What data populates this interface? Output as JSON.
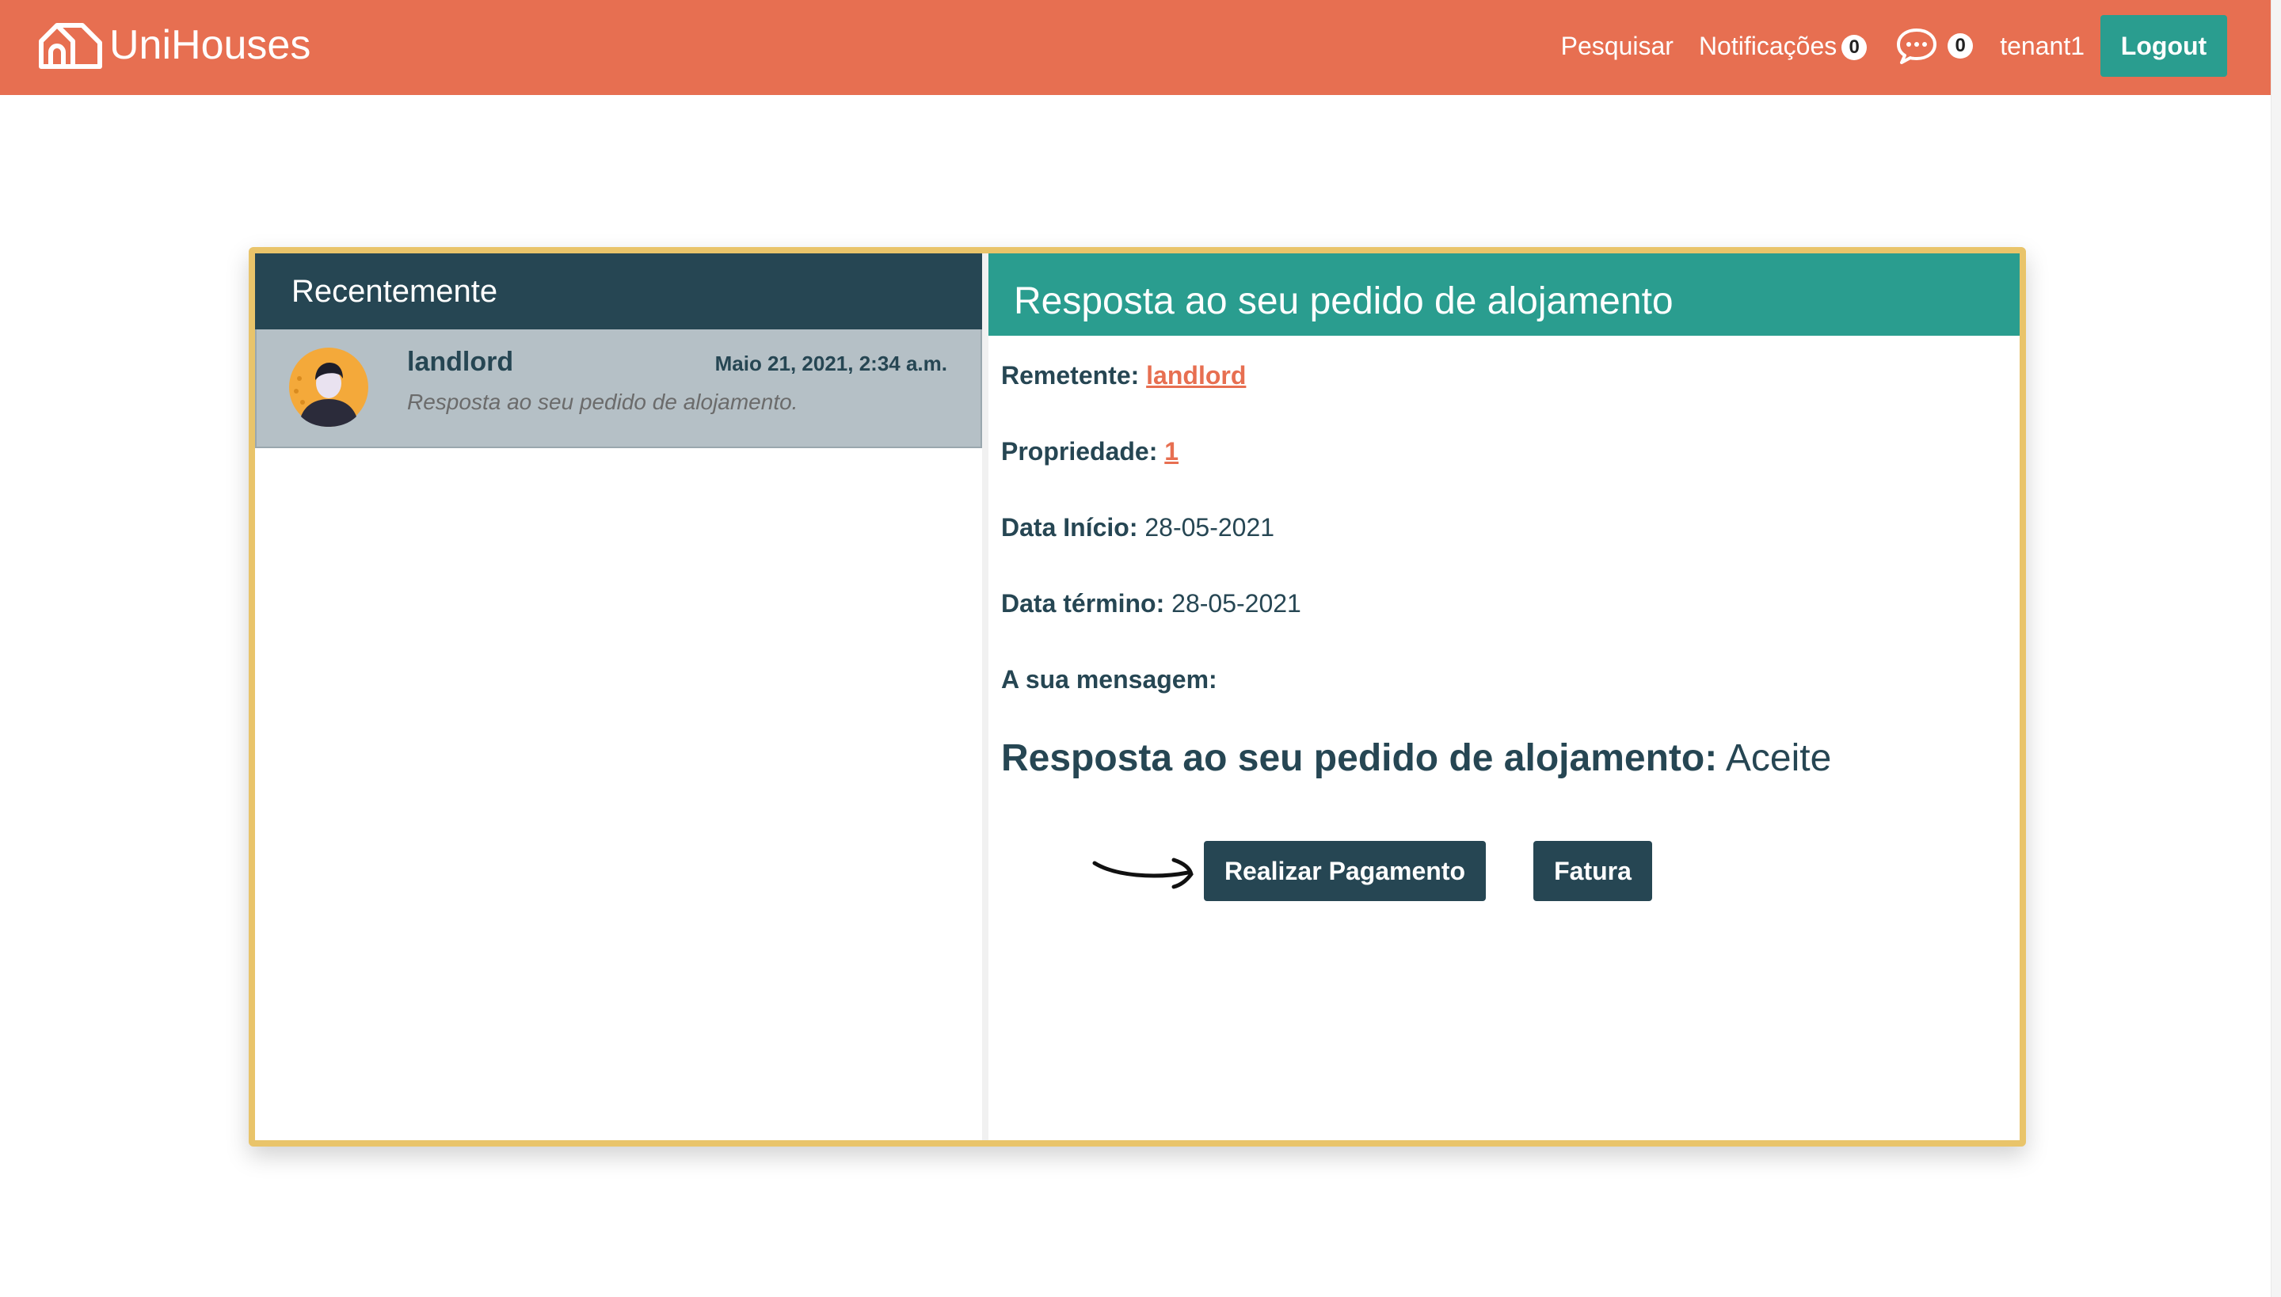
{
  "header": {
    "brand": "UniHouses",
    "nav": {
      "search": "Pesquisar",
      "notifications": "Notificações",
      "notifications_count": "0",
      "messages_count": "0",
      "username": "tenant1",
      "logout": "Logout"
    }
  },
  "sidebar": {
    "title": "Recentemente",
    "messages": [
      {
        "sender": "landlord",
        "date": "Maio 21, 2021, 2:34 a.m.",
        "preview": "Resposta ao seu pedido de alojamento."
      }
    ]
  },
  "detail": {
    "title": "Resposta ao seu pedido de alojamento",
    "sender_label": "Remetente:",
    "sender_value": "landlord",
    "property_label": "Propriedade:",
    "property_value": "1",
    "start_label": "Data Início:",
    "start_value": "28-05-2021",
    "end_label": "Data término:",
    "end_value": "28-05-2021",
    "message_label": "A sua mensagem:",
    "response_label": "Resposta ao seu pedido de alojamento:",
    "response_value": "Aceite",
    "pay_button": "Realizar Pagamento",
    "invoice_button": "Fatura"
  },
  "colors": {
    "navbar": "#e76f51",
    "accent": "#2a9d8f",
    "dark": "#264653",
    "frame": "#e9c46a"
  }
}
